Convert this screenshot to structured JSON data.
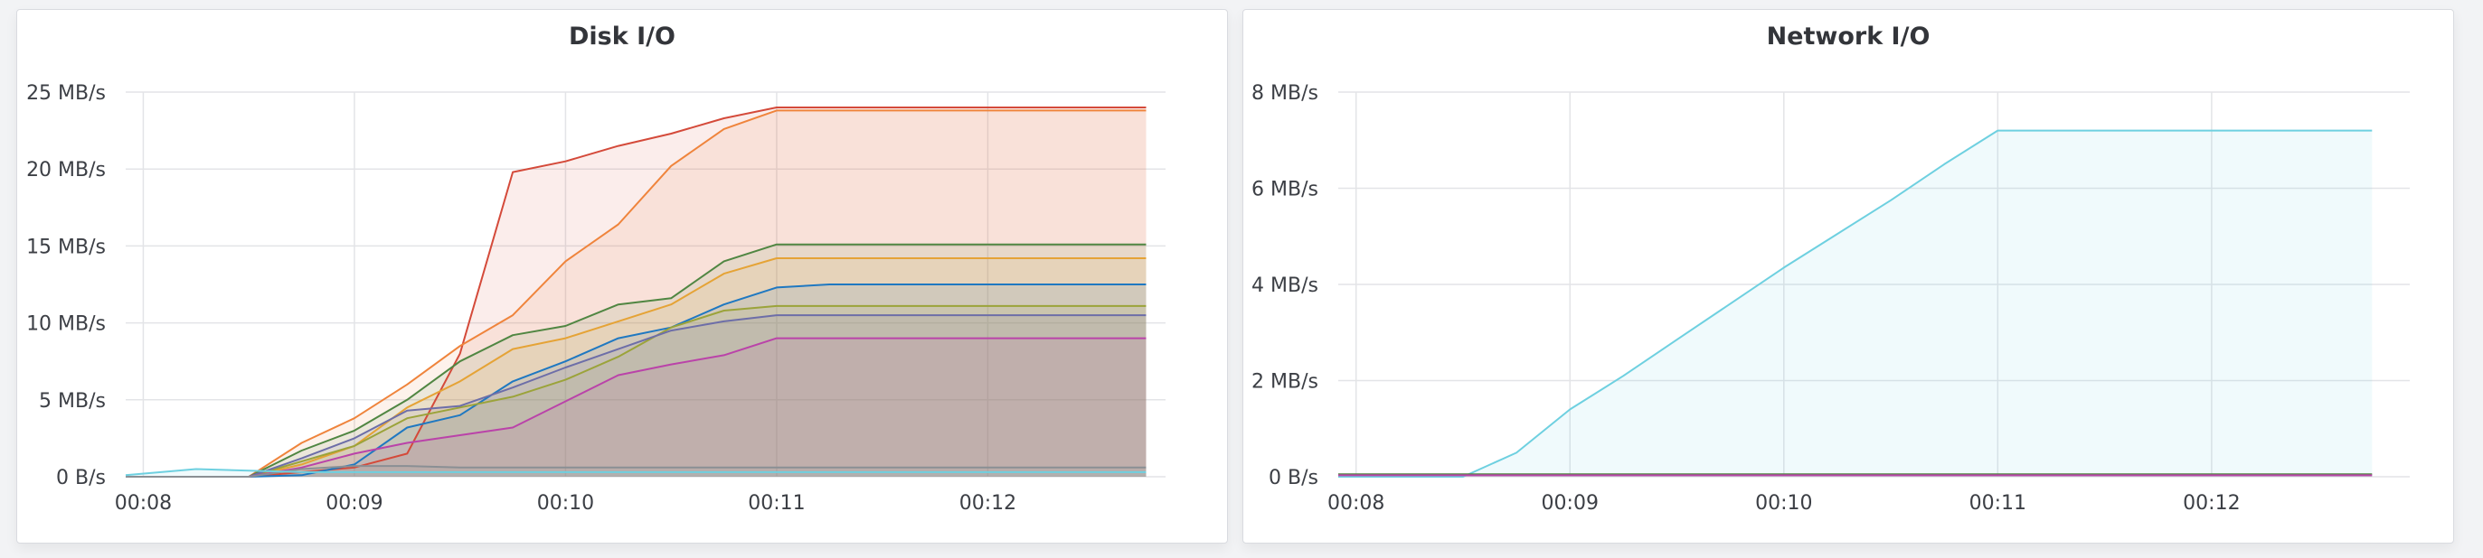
{
  "chart_data": [
    {
      "type": "area",
      "title": "Disk I/O",
      "x": [
        "00:07:55",
        "00:08:15",
        "00:08:30",
        "00:08:45",
        "00:09:00",
        "00:09:15",
        "00:09:30",
        "00:09:45",
        "00:10:00",
        "00:10:15",
        "00:10:30",
        "00:10:45",
        "00:11:00",
        "00:11:15",
        "00:11:30",
        "00:11:45",
        "00:12:00",
        "00:12:15",
        "00:12:30",
        "00:12:45"
      ],
      "x_ticks": [
        "00:08",
        "00:09",
        "00:10",
        "00:11",
        "00:12"
      ],
      "x_tick_values": [
        "00:08:00",
        "00:09:00",
        "00:10:00",
        "00:11:00",
        "00:12:00"
      ],
      "xlim": [
        "00:07:55",
        "00:12:50"
      ],
      "y_ticks": [
        "0 B/s",
        "5 MB/s",
        "10 MB/s",
        "15 MB/s",
        "20 MB/s",
        "25 MB/s"
      ],
      "y_tick_values": [
        0,
        5,
        10,
        15,
        20,
        25
      ],
      "ylim": [
        0,
        25
      ],
      "grid": true,
      "series": [
        {
          "color": "#d44a3a",
          "values": [
            0,
            0,
            0,
            0.3,
            0.6,
            1.5,
            8,
            19.8,
            20.5,
            21.5,
            22.3,
            23.3,
            24,
            24,
            24,
            24,
            24,
            24,
            24,
            24
          ]
        },
        {
          "color": "#ef843c",
          "values": [
            0,
            0,
            0,
            2.2,
            3.8,
            6,
            8.5,
            10.5,
            14,
            16.4,
            20.2,
            22.6,
            23.8,
            23.8,
            23.8,
            23.8,
            23.8,
            23.8,
            23.8,
            23.8
          ]
        },
        {
          "color": "#508642",
          "values": [
            0,
            0,
            0,
            1.7,
            3,
            5,
            7.5,
            9.2,
            9.8,
            11.2,
            11.6,
            14,
            15.1,
            15.1,
            15.1,
            15.1,
            15.1,
            15.1,
            15.1,
            15.1
          ]
        },
        {
          "color": "#e5a336",
          "values": [
            0,
            0,
            0,
            0.8,
            2,
            4.5,
            6.2,
            8.3,
            9,
            10.1,
            11.2,
            13.2,
            14.2,
            14.2,
            14.2,
            14.2,
            14.2,
            14.2,
            14.2,
            14.2
          ]
        },
        {
          "color": "#1f78c1",
          "values": [
            0,
            0,
            0,
            0.1,
            0.8,
            3.2,
            4,
            6.2,
            7.5,
            9,
            9.7,
            11.2,
            12.3,
            12.5,
            12.5,
            12.5,
            12.5,
            12.5,
            12.5,
            12.5
          ]
        },
        {
          "color": "#9ba33a",
          "values": [
            0,
            0,
            0,
            1,
            2,
            3.8,
            4.5,
            5.2,
            6.3,
            7.8,
            9.7,
            10.8,
            11.1,
            11.1,
            11.1,
            11.1,
            11.1,
            11.1,
            11.1,
            11.1
          ]
        },
        {
          "color": "#6d6ea8",
          "values": [
            0,
            0,
            0,
            1.2,
            2.5,
            4.3,
            4.6,
            5.8,
            7.1,
            8.3,
            9.5,
            10.1,
            10.5,
            10.5,
            10.5,
            10.5,
            10.5,
            10.5,
            10.5,
            10.5
          ]
        },
        {
          "color": "#ba43a9",
          "values": [
            0,
            0,
            0,
            0.6,
            1.5,
            2.2,
            2.7,
            3.2,
            4.9,
            6.6,
            7.3,
            7.9,
            9,
            9,
            9,
            9,
            9,
            9,
            9,
            9
          ]
        },
        {
          "color": "#8a8f94",
          "values": [
            0,
            0,
            0,
            0.5,
            0.7,
            0.7,
            0.6,
            0.6,
            0.6,
            0.6,
            0.6,
            0.6,
            0.6,
            0.6,
            0.6,
            0.6,
            0.6,
            0.6,
            0.6,
            0.6
          ]
        },
        {
          "color": "#6ed0e0",
          "values": [
            0.1,
            0.5,
            0.4,
            0.3,
            0.3,
            0.3,
            0.3,
            0.3,
            0.3,
            0.3,
            0.3,
            0.3,
            0.3,
            0.3,
            0.3,
            0.3,
            0.3,
            0.3,
            0.3,
            0.3
          ]
        }
      ]
    },
    {
      "type": "area",
      "title": "Network I/O",
      "x": [
        "00:07:55",
        "00:08:15",
        "00:08:30",
        "00:08:45",
        "00:09:00",
        "00:09:15",
        "00:09:30",
        "00:09:45",
        "00:10:00",
        "00:10:15",
        "00:10:30",
        "00:10:45",
        "00:11:00",
        "00:11:15",
        "00:11:30",
        "00:11:45",
        "00:12:00",
        "00:12:15",
        "00:12:30",
        "00:12:45"
      ],
      "x_ticks": [
        "00:08",
        "00:09",
        "00:10",
        "00:11",
        "00:12"
      ],
      "x_tick_values": [
        "00:08:00",
        "00:09:00",
        "00:10:00",
        "00:11:00",
        "00:12:00"
      ],
      "xlim": [
        "00:07:55",
        "00:12:50"
      ],
      "y_ticks": [
        "0 B/s",
        "2 MB/s",
        "4 MB/s",
        "6 MB/s",
        "8 MB/s"
      ],
      "y_tick_values": [
        0,
        2,
        4,
        6,
        8
      ],
      "ylim": [
        0,
        8
      ],
      "grid": true,
      "series": [
        {
          "color": "#6ed0e0",
          "values": [
            0,
            0,
            0,
            0.5,
            1.4,
            2.1,
            2.85,
            3.6,
            4.35,
            5.05,
            5.75,
            6.5,
            7.2,
            7.2,
            7.2,
            7.2,
            7.2,
            7.2,
            7.2,
            7.2
          ]
        },
        {
          "color": "#508642",
          "values": [
            0.05,
            0.05,
            0.05,
            0.05,
            0.05,
            0.05,
            0.05,
            0.05,
            0.05,
            0.05,
            0.05,
            0.05,
            0.05,
            0.05,
            0.05,
            0.05,
            0.05,
            0.05,
            0.05,
            0.05
          ]
        },
        {
          "color": "#ba43a9",
          "values": [
            0.03,
            0.03,
            0.03,
            0.03,
            0.03,
            0.03,
            0.03,
            0.03,
            0.03,
            0.03,
            0.03,
            0.03,
            0.03,
            0.03,
            0.03,
            0.03,
            0.03,
            0.03,
            0.03,
            0.03
          ]
        }
      ]
    }
  ]
}
